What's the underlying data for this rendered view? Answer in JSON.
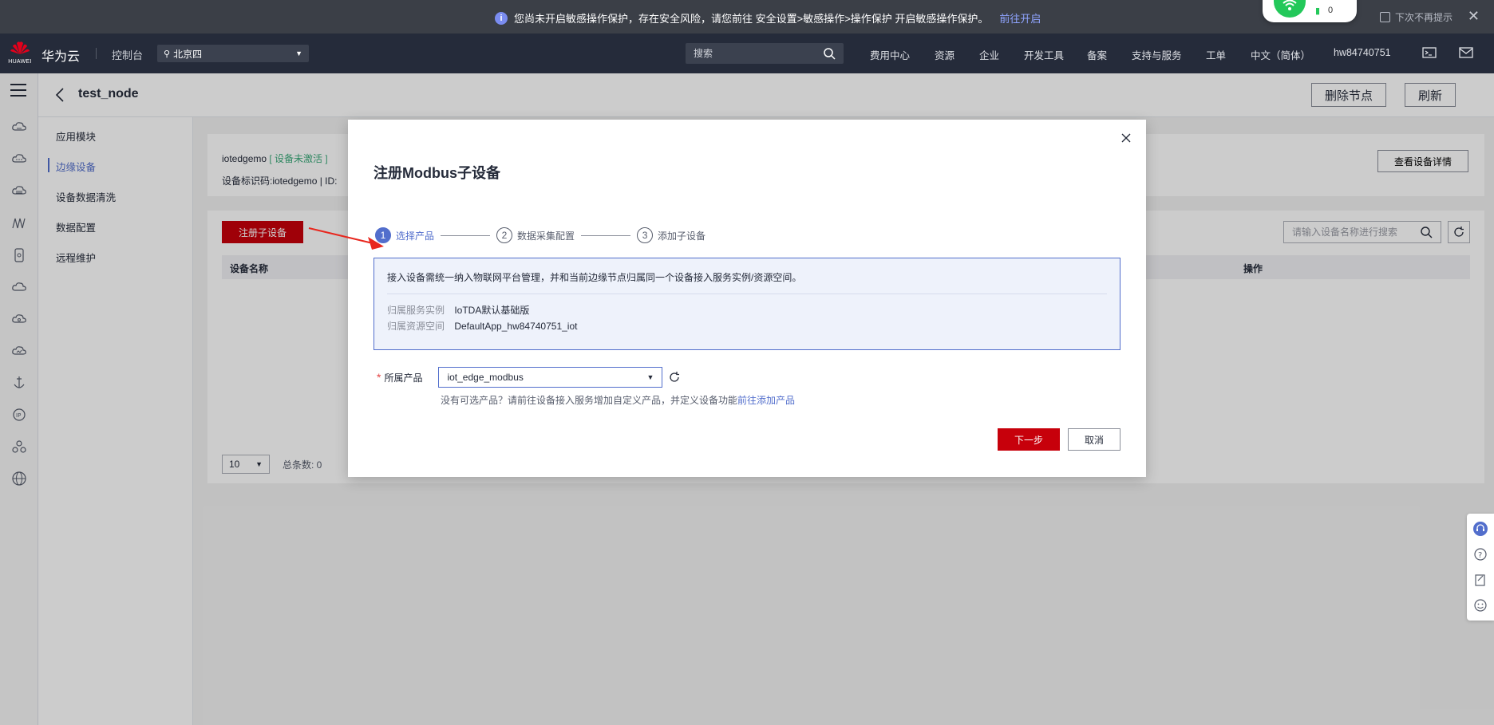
{
  "notice": {
    "message": "您尚未开启敏感操作保护，存在安全风险，请您前往 安全设置>敏感操作>操作保护 开启敏感操作保护。",
    "link": "前往开启",
    "no_more": "下次不再提示",
    "widget_count": "0"
  },
  "topnav": {
    "logo_text": "HUAWEI",
    "brand": "华为云",
    "console": "控制台",
    "region": "北京四",
    "search_placeholder": "搜索",
    "items": [
      "费用中心",
      "资源",
      "企业",
      "开发工具",
      "备案",
      "支持与服务",
      "工单",
      "中文（简体）",
      "hw84740751"
    ]
  },
  "page": {
    "title": "test_node",
    "delete_node": "删除节点",
    "refresh": "刷新"
  },
  "sidebar": {
    "items": [
      "应用模块",
      "边缘设备",
      "设备数据清洗",
      "数据配置",
      "远程维护"
    ],
    "active_index": 1
  },
  "device_card": {
    "name": "iotedgemo",
    "status": "[ 设备未激活 ]",
    "id_line": "设备标识码:iotedgemo    |    ID:",
    "detail_button": "查看设备详情"
  },
  "list_card": {
    "register_button": "注册子设备",
    "search_placeholder": "请输入设备名称进行搜索",
    "columns": [
      "设备名称",
      "操作"
    ],
    "page_size": "10",
    "total_label": "总条数:  0"
  },
  "modal": {
    "title": "注册Modbus子设备",
    "steps": [
      {
        "num": "1",
        "label": "选择产品"
      },
      {
        "num": "2",
        "label": "数据采集配置"
      },
      {
        "num": "3",
        "label": "添加子设备"
      }
    ],
    "active_step": 0,
    "info_text": "接入设备需统一纳入物联网平台管理，并和当前边缘节点归属同一个设备接入服务实例/资源空间。",
    "instance_label": "归属服务实例",
    "instance_value": "IoTDA默认基础版",
    "space_label": "归属资源空间",
    "space_value": "DefaultApp_hw84740751_iot",
    "required_mark": "*",
    "product_label": "所属产品",
    "product_value": "iot_edge_modbus",
    "hint_text": "没有可选产品？请前往设备接入服务增加自定义产品，并定义设备功能",
    "hint_link": "前往添加产品",
    "next_button": "下一步",
    "cancel_button": "取消"
  },
  "colors": {
    "brand_red": "#c7000b",
    "accent_blue": "#526ecc",
    "nav_bg": "#252b3a",
    "notice_bg": "#3b3f47",
    "status_green": "#3daa7b"
  },
  "icons": [
    "info-icon",
    "wifi-icon",
    "battery-icon",
    "close-icon",
    "huawei-logo-icon",
    "location-pin-icon",
    "search-icon",
    "terminal-icon",
    "mail-icon",
    "menu-icon",
    "back-arrow-icon",
    "refresh-icon",
    "chevron-down-icon",
    "headset-icon",
    "help-icon",
    "feedback-icon",
    "smile-icon"
  ]
}
